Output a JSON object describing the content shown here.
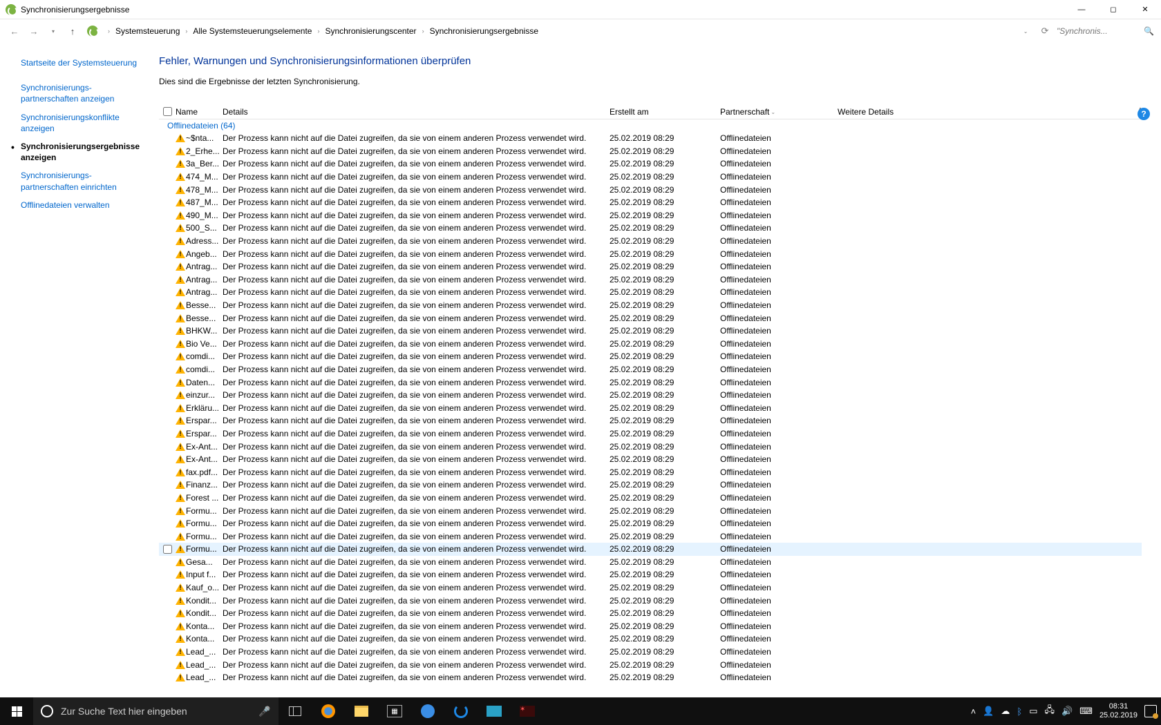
{
  "window": {
    "title": "Synchronisierungsergebnisse"
  },
  "breadcrumb": [
    "Systemsteuerung",
    "Alle Systemsteuerungselemente",
    "Synchronisierungscenter",
    "Synchronisierungsergebnisse"
  ],
  "search": {
    "placeholder": "\"Synchronis..."
  },
  "sidebar": {
    "head": "Startseite der Systemsteuerung",
    "items": [
      "Synchronisierungs-\npartnerschaften anzeigen",
      "Synchronisierungskonflikte anzeigen",
      "Synchronisierungsergebnisse anzeigen",
      "Synchronisierungs-\npartnerschaften einrichten",
      "Offlinedateien verwalten"
    ],
    "activeIndex": 2
  },
  "main": {
    "heading": "Fehler, Warnungen und Synchronisierungsinformationen überprüfen",
    "sub": "Dies sind die Ergebnisse der letzten Synchronisierung."
  },
  "columns": {
    "name": "Name",
    "details": "Details",
    "created": "Erstellt am",
    "partner": "Partnerschaft",
    "more": "Weitere Details"
  },
  "group": "Offlinedateien (64)",
  "detailText": "Der Prozess kann nicht auf die Datei zugreifen, da sie von einem anderen Prozess verwendet wird.",
  "created": "25.02.2019 08:29",
  "partner": "Offlinedateien",
  "hoverIndex": 32,
  "rows": [
    "~$nta...",
    "2_Erhe...",
    "3a_Ber...",
    "474_M...",
    "478_M...",
    "487_M...",
    "490_M...",
    "500_S...",
    "Adress...",
    "Angeb...",
    "Antrag...",
    "Antrag...",
    "Antrag...",
    "Besse...",
    "Besse...",
    "BHKW...",
    "Bio Ve...",
    "comdi...",
    "comdi...",
    "Daten...",
    "einzur...",
    "Erkläru...",
    "Erspar...",
    "Erspar...",
    "Ex-Ant...",
    "Ex-Ant...",
    "fax.pdf...",
    "Finanz...",
    "Forest ...",
    "Formu...",
    "Formu...",
    "Formu...",
    "Formu...",
    "Gesa...",
    "Input f...",
    "Kauf_o...",
    "Kondit...",
    "Kondit...",
    "Konta...",
    "Konta...",
    "Lead_...",
    "Lead_...",
    "Lead_..."
  ],
  "taskbar": {
    "search": "Zur Suche Text hier eingeben",
    "time": "08:31",
    "date": "25.02.2019"
  }
}
